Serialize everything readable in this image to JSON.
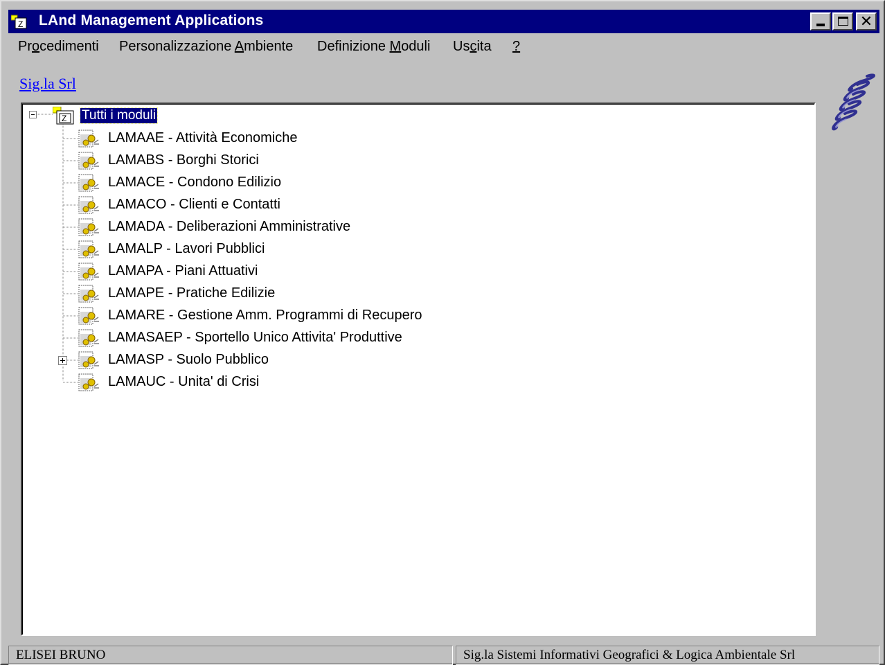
{
  "window": {
    "title": "LAnd Management Applications"
  },
  "menu": {
    "items": [
      {
        "pre": "Pr",
        "accel": "o",
        "post": "cedimenti"
      },
      {
        "pre": "Personalizzazione ",
        "accel": "A",
        "post": "mbiente"
      },
      {
        "pre": "Definizione ",
        "accel": "M",
        "post": "oduli"
      },
      {
        "pre": "Us",
        "accel": "c",
        "post": "ita"
      },
      {
        "pre": "",
        "accel": "?",
        "post": ""
      }
    ]
  },
  "company_link": "Sig.la Srl",
  "tree": {
    "root_label": "Tutti i moduli",
    "items": [
      "LAMAAE - Attività Economiche",
      "LAMABS - Borghi Storici",
      "LAMACE - Condono Edilizio",
      "LAMACO - Clienti e Contatti",
      "LAMADA - Deliberazioni Amministrative",
      "LAMALP - Lavori Pubblici",
      "LAMAPA - Piani Attuativi",
      "LAMAPE - Pratiche Edilizie",
      "LAMARE - Gestione Amm. Programmi di Recupero",
      "LAMASAEP - Sportello Unico Attivita' Produttive",
      "LAMASP - Suolo Pubblico",
      "LAMAUC - Unita' di Crisi"
    ]
  },
  "status": {
    "user": "ELISEI BRUNO",
    "company": "Sig.la Sistemi Informativi Geografici & Logica Ambientale Srl"
  },
  "colors": {
    "titlebar": "#000080",
    "face": "#c0c0c0",
    "link": "#0000ff",
    "selection": "#000080"
  },
  "icons": [
    "app-icon",
    "minimize-icon",
    "maximize-icon",
    "close-icon",
    "spring-logo-icon",
    "folder-icon",
    "module-icon",
    "collapse-icon",
    "expand-icon"
  ]
}
